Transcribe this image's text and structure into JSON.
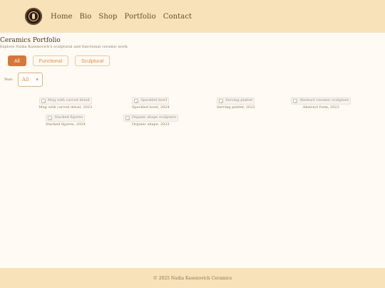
{
  "nav": {
    "items": [
      {
        "label": "Home"
      },
      {
        "label": "Bio"
      },
      {
        "label": "Shop"
      },
      {
        "label": "Portfolio"
      },
      {
        "label": "Contact"
      }
    ]
  },
  "page": {
    "title": "Ceramics Portfolio",
    "subtitle": "Explore Nadia Kasenovich's sculptural and functional ceramic work."
  },
  "filters": {
    "chips": [
      {
        "label": "All",
        "active": true
      },
      {
        "label": "Functional",
        "active": false
      },
      {
        "label": "Sculptural",
        "active": false
      }
    ],
    "year_label": "Year:",
    "year_value": "All"
  },
  "gallery": {
    "items": [
      {
        "alt": "Mug with carved detail",
        "caption": "Mug with carved detail, 2023"
      },
      {
        "alt": "Speckled bowl",
        "caption": "Speckled bowl, 2024"
      },
      {
        "alt": "Serving platter",
        "caption": "Serving platter, 2023"
      },
      {
        "alt": "Abstract ceramic sculpture",
        "caption": "Abstract form, 2023"
      },
      {
        "alt": "Stacked figures",
        "caption": "Stacked figures, 2024"
      },
      {
        "alt": "Organic shape sculpture",
        "caption": "Organic shape, 2023"
      }
    ]
  },
  "footer": {
    "text": "© 2025 Nadia Kasenovich Ceramics"
  }
}
